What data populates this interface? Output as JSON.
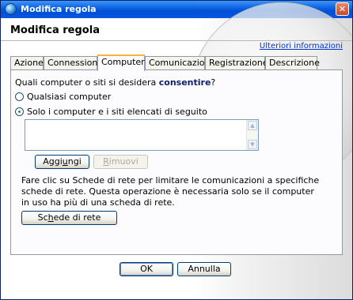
{
  "window": {
    "title": "Modifica regola",
    "close_glyph": "✕",
    "icon": "globe-icon"
  },
  "header": {
    "heading": "Modifica regola",
    "more_info_link": "Ulteriori informazioni"
  },
  "tabs": [
    {
      "label": "Azione",
      "active": false
    },
    {
      "label": "Connessioni",
      "active": false
    },
    {
      "label": "Computer",
      "active": true
    },
    {
      "label": "Comunicazioni",
      "active": false
    },
    {
      "label": "Registrazione",
      "active": false
    },
    {
      "label": "Descrizione",
      "active": false
    }
  ],
  "panel": {
    "question_prefix": "Quali computer o siti si desidera ",
    "question_emphasis": "consentire",
    "question_suffix": "?",
    "options": [
      {
        "label": "Qualsiasi computer",
        "checked": false
      },
      {
        "label": "Solo i computer e i siti elencati di seguito",
        "checked": true
      }
    ],
    "add_button": {
      "pre": "Aggi",
      "access_key": "u",
      "post": "ngi"
    },
    "remove_button": {
      "pre": "",
      "access_key": "R",
      "post": "imuovi"
    },
    "info_text": "Fare clic su Schede di rete per limitare le comunicazioni a specifiche schede di rete. Questa operazione è necessaria solo se il computer in uso ha più di una scheda di rete.",
    "network_button": {
      "pre": "Sc",
      "access_key": "h",
      "post": "ede di rete"
    }
  },
  "footer": {
    "ok_label": "OK",
    "cancel_label": "Annulla"
  },
  "colors": {
    "titlebar": "#0a5fdc",
    "emphasis": "#0d1f6a",
    "link": "#0033cc"
  }
}
